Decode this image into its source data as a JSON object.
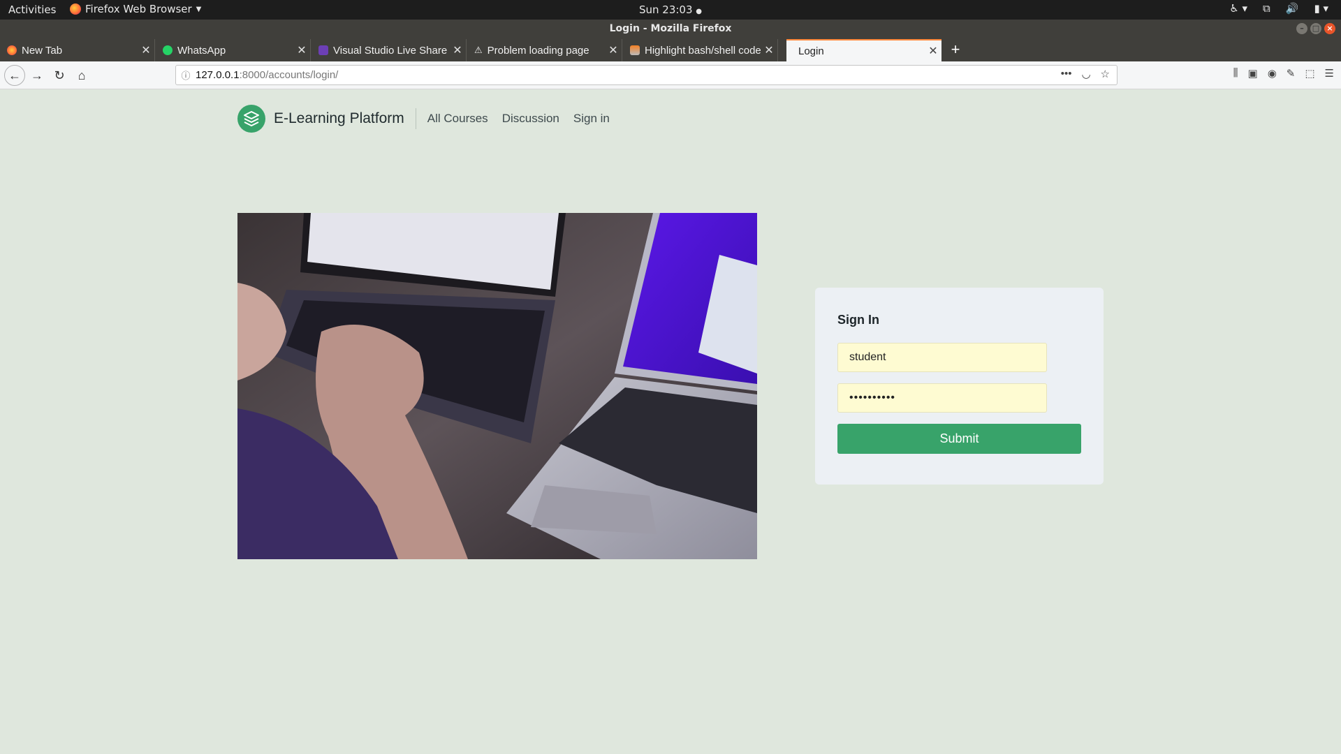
{
  "os_bar": {
    "activities": "Activities",
    "app_name": "Firefox Web Browser",
    "clock": "Sun 23:03"
  },
  "window": {
    "title": "Login - Mozilla Firefox"
  },
  "tabs": [
    {
      "label": "New Tab",
      "icon": "firefox-icon"
    },
    {
      "label": "WhatsApp",
      "icon": "whatsapp-icon"
    },
    {
      "label": "Visual Studio Live Share",
      "icon": "vs-live-share-icon"
    },
    {
      "label": "Problem loading page",
      "icon": "warning-icon"
    },
    {
      "label": "Highlight bash/shell code",
      "icon": "stackoverflow-icon"
    },
    {
      "label": "Login",
      "icon": "",
      "active": true
    }
  ],
  "address_bar": {
    "host": "127.0.0.1",
    "path": ":8000/accounts/login/"
  },
  "site": {
    "brand": "E-Learning Platform",
    "nav": [
      "All Courses",
      "Discussion",
      "Sign in"
    ]
  },
  "signin": {
    "title": "Sign In",
    "username_value": "student",
    "password_value": "••••••••••",
    "submit_label": "Submit"
  },
  "colors": {
    "page_bg": "#dfe7dd",
    "brand_green": "#38a36a",
    "autofill_yellow": "#fefbd2",
    "card_bg": "#ecf0f4"
  }
}
